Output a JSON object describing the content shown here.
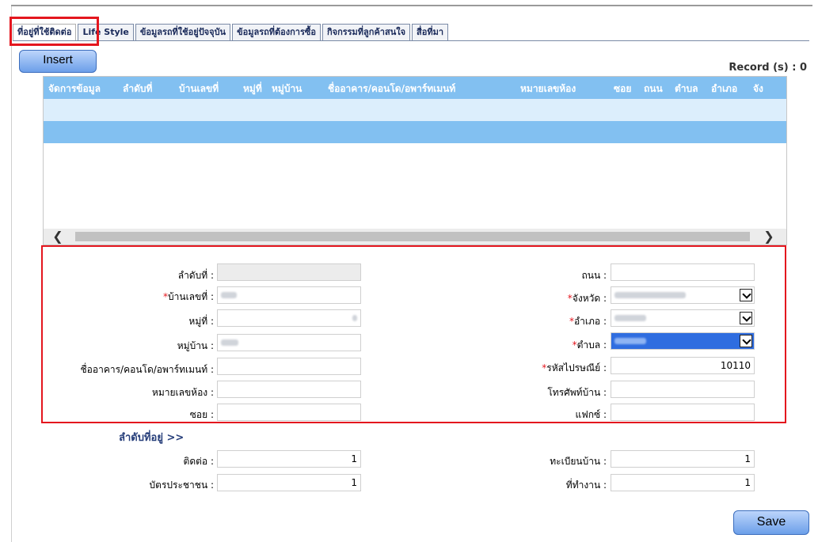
{
  "tabs": [
    {
      "label": "ที่อยู่ที่ใช้ติดต่อ",
      "active": true
    },
    {
      "label": "Life Style",
      "active": false
    },
    {
      "label": "ข้อมูลรถที่ใช้อยู่ปัจจุบัน",
      "active": false
    },
    {
      "label": "ข้อมูลรถที่ต้องการซื้อ",
      "active": false
    },
    {
      "label": "กิจกรรมที่ลูกค้าสนใจ",
      "active": false
    },
    {
      "label": "สื่อที่มา",
      "active": false
    }
  ],
  "toolbar": {
    "insert_label": "Insert",
    "record_label": "Record (s) : 0",
    "save_label": "Save"
  },
  "grid": {
    "columns": [
      "จัดการข้อมูล",
      "ลำดับที่",
      "บ้านเลขที่",
      "หมู่ที่",
      "หมู่บ้าน",
      "ชื่ออาคาร/คอนโด/อพาร์ทเมนท์",
      "หมายเลขห้อง",
      "ซอย",
      "ถนน",
      "ตำบล",
      "อำเภอ",
      "จัง"
    ]
  },
  "form": {
    "left": [
      {
        "label": "ลำดับที่ :",
        "required": false,
        "value": ""
      },
      {
        "label": "บ้านเลขที่ :",
        "required": true,
        "value": ""
      },
      {
        "label": "หมู่ที่ :",
        "required": false,
        "value": ""
      },
      {
        "label": "หมู่บ้าน :",
        "required": false,
        "value": ""
      },
      {
        "label": "ชื่ออาคาร/คอนโด/อพาร์ทเมนท์ :",
        "required": false,
        "value": ""
      },
      {
        "label": "หมายเลขห้อง :",
        "required": false,
        "value": ""
      },
      {
        "label": "ซอย :",
        "required": false,
        "value": ""
      }
    ],
    "right": [
      {
        "label": "ถนน :",
        "required": false,
        "value": ""
      },
      {
        "label": "จังหวัด :",
        "required": true,
        "value": ""
      },
      {
        "label": "อำเภอ :",
        "required": true,
        "value": ""
      },
      {
        "label": "ตำบล :",
        "required": true,
        "value": ""
      },
      {
        "label": "รหัสไปรษณีย์ :",
        "required": true,
        "value": "10110"
      },
      {
        "label": "โทรศัพท์บ้าน :",
        "required": false,
        "value": ""
      },
      {
        "label": "แฟกซ์ :",
        "required": false,
        "value": ""
      }
    ],
    "required_mark": "*"
  },
  "address_order": {
    "title": "ลำดับที่อยู่ >>",
    "contact": {
      "label": "ติดต่อ :",
      "value": "1"
    },
    "id_card": {
      "label": "บัตรประชาชน :",
      "value": "1"
    },
    "house_reg": {
      "label": "ทะเบียนบ้าน :",
      "value": "1"
    },
    "workplace": {
      "label": "ที่ทำงาน :",
      "value": "1"
    }
  },
  "colors": {
    "accent": "#82c0f1",
    "highlight": "#e4161e",
    "button": "#6c9fe9"
  }
}
